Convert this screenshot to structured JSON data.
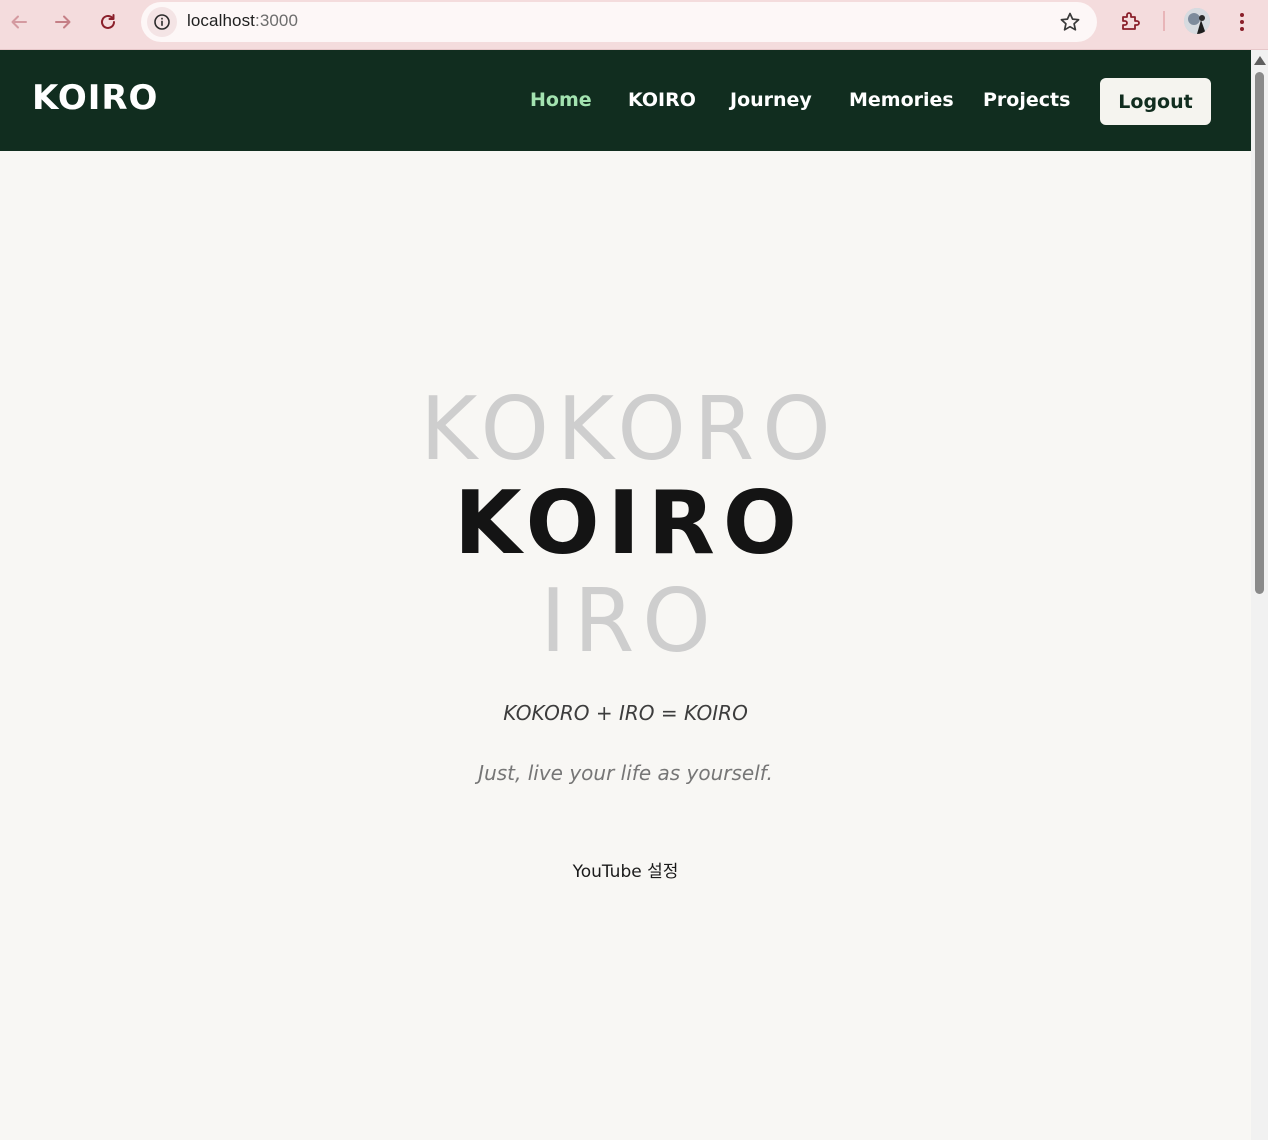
{
  "browser": {
    "url_host": "localhost",
    "url_port": ":3000",
    "icons": {
      "back": "back-arrow-icon",
      "forward": "forward-arrow-icon",
      "reload": "reload-icon",
      "info": "info-icon",
      "bookmark": "star-icon",
      "extensions": "puzzle-icon",
      "menu": "kebab-menu-icon"
    }
  },
  "header": {
    "brand": "KOIRO",
    "nav": [
      {
        "label": "Home",
        "active": true
      },
      {
        "label": "KOIRO",
        "active": false
      },
      {
        "label": "Journey",
        "active": false
      },
      {
        "label": "Memories",
        "active": false
      },
      {
        "label": "Projects",
        "active": false
      }
    ],
    "logout_label": "Logout"
  },
  "hero": {
    "line_top": "KOKORO",
    "line_main": "KOIRO",
    "line_bottom": "IRO",
    "equation": "KOKORO + IRO = KOIRO",
    "tagline": "Just, live your life as yourself.",
    "youtube_label": "YouTube 설정"
  },
  "colors": {
    "header_bg": "#112d1f",
    "nav_active": "#a3e3b0",
    "page_bg": "#f8f7f4",
    "chrome_bg": "#f4dcdd",
    "hero_faded": "#cecece",
    "hero_main": "#141414"
  }
}
